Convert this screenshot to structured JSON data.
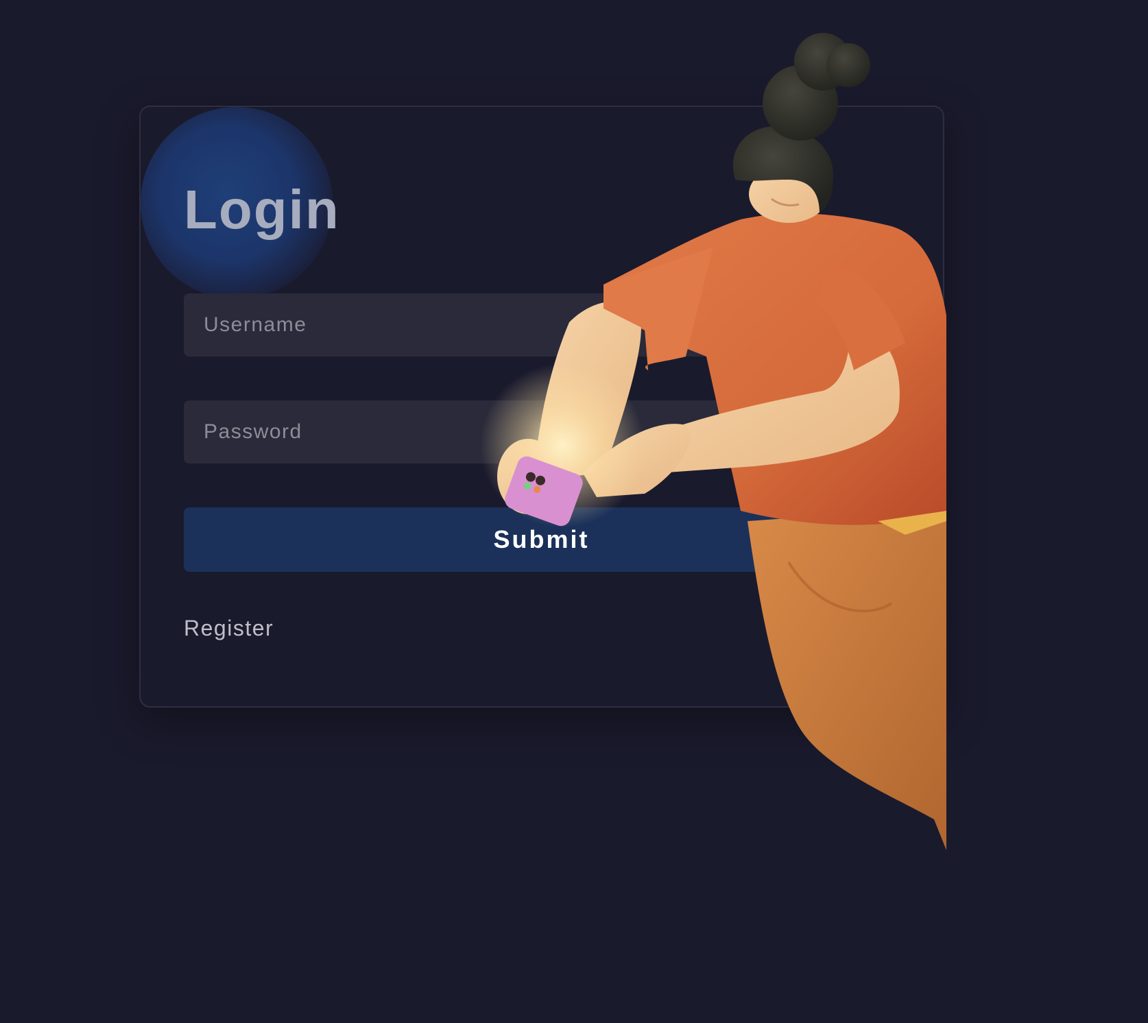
{
  "login_form": {
    "title": "Login",
    "username_placeholder": "Username",
    "password_placeholder": "Password",
    "submit_label": "Submit",
    "register_label": "Register"
  },
  "illustration": {
    "subject": "person-with-phone-illustration",
    "colors": {
      "shirt": "#d9703f",
      "skin": "#f0c89a",
      "hair": "#2f2f2a",
      "pants": "#c9803f",
      "phone": "#d990d0"
    }
  },
  "colors": {
    "background": "#1a1a2d",
    "card_border": "#2e2e42",
    "field_background": "#2a2a3a",
    "submit_background": "#1b315a",
    "accent_glow": "#1f3f78"
  }
}
